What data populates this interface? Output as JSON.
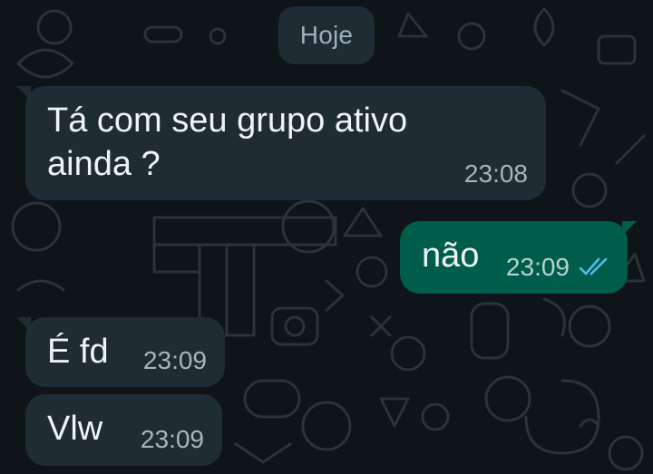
{
  "date_divider": "Hoje",
  "messages": [
    {
      "text": "Tá com seu grupo ativo\nainda ?",
      "time": "23:08",
      "direction": "incoming"
    },
    {
      "text": "não",
      "time": "23:09",
      "direction": "outgoing",
      "status_icon": "double-check-read-icon"
    },
    {
      "text": "É fd",
      "time": "23:09",
      "direction": "incoming"
    },
    {
      "text": "Vlw",
      "time": "23:09",
      "direction": "incoming"
    }
  ],
  "colors": {
    "background": "#0e1418",
    "incoming_bubble": "#1f2c33",
    "outgoing_bubble": "#005c4b",
    "read_ticks": "#53bdeb"
  }
}
